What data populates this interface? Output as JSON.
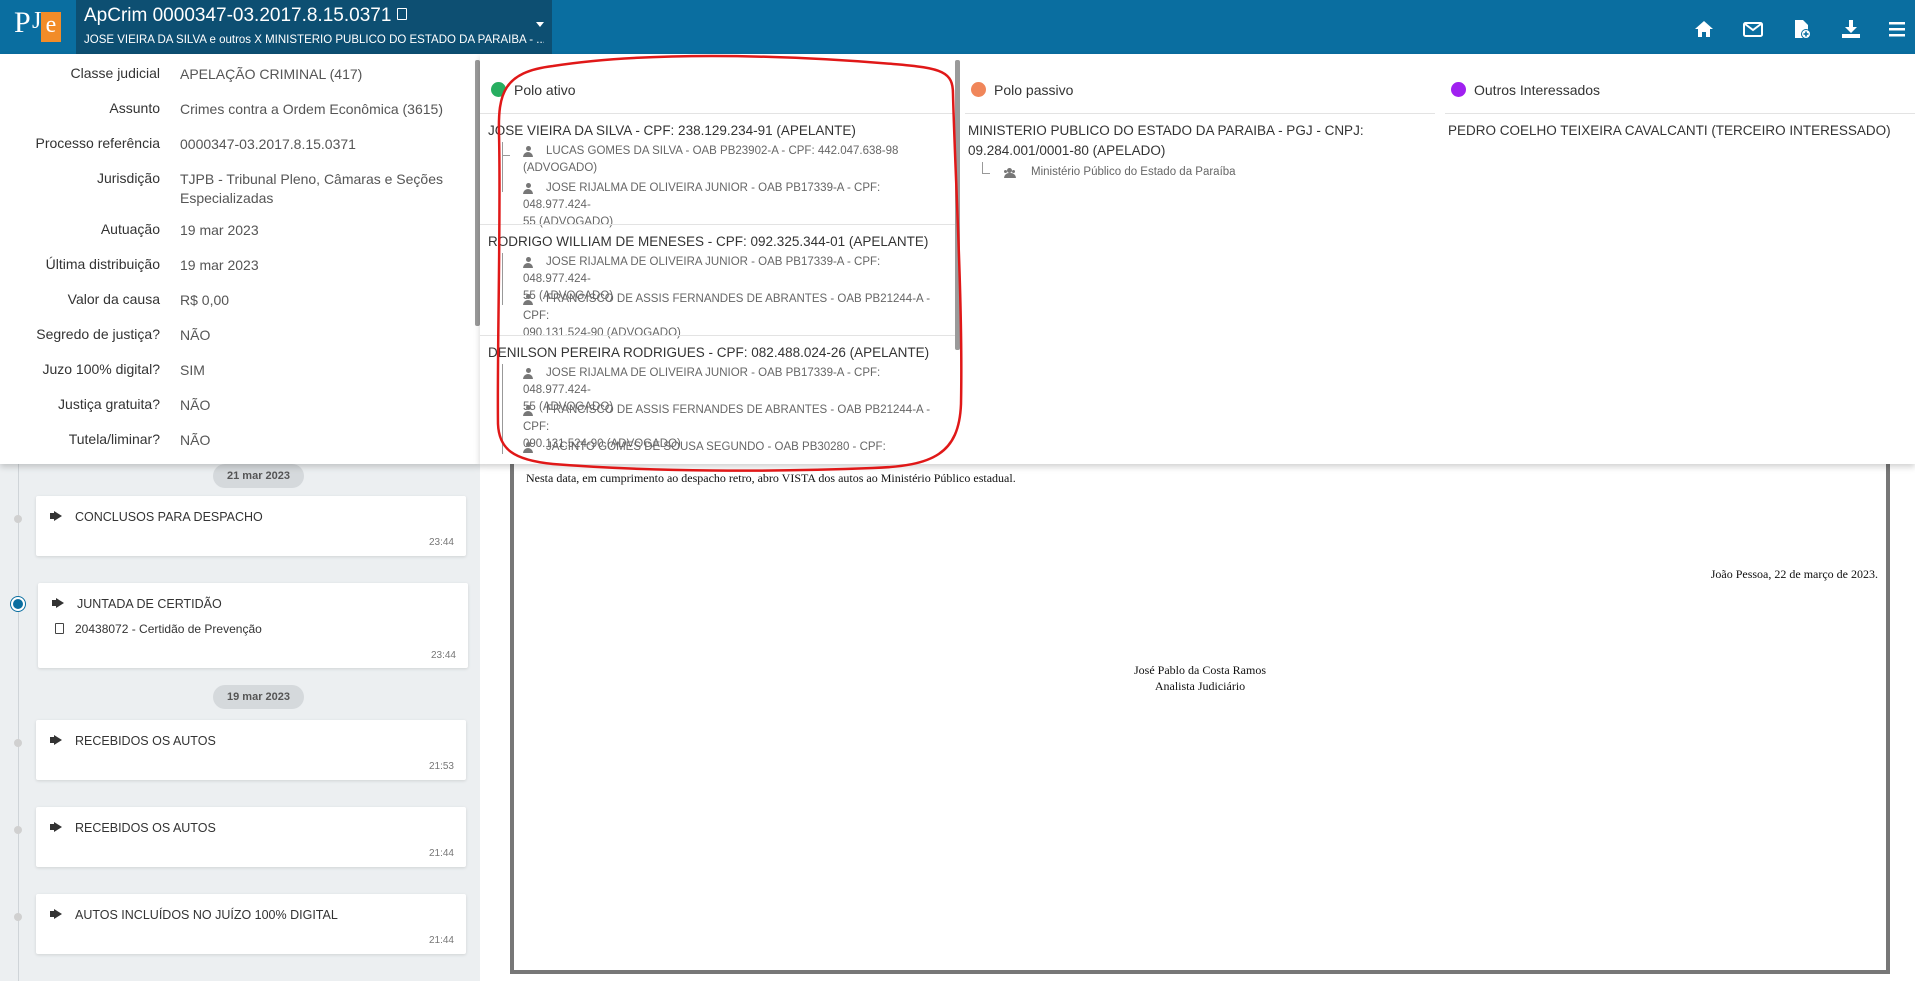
{
  "header": {
    "process_title": "ApCrim 0000347-03.2017.8.15.0371",
    "process_subtitle": "JOSE VIEIRA DA SILVA e outros X MINISTERIO PUBLICO DO ESTADO DA PARAIBA - ...",
    "logo_p": "P",
    "logo_j": "J",
    "logo_e": "e"
  },
  "info": [
    {
      "label": "Classe judicial",
      "value": "APELAÇÃO CRIMINAL (417)"
    },
    {
      "label": "Assunto",
      "value": "Crimes contra a Ordem Econômica (3615)"
    },
    {
      "label": "Processo referência",
      "value": "0000347-03.2017.8.15.0371"
    },
    {
      "label": "Jurisdição",
      "value": "TJPB - Tribunal Pleno, Câmaras e Seções Especializadas"
    },
    {
      "label": "Autuação",
      "value": "19 mar 2023"
    },
    {
      "label": "Última distribuição",
      "value": "19 mar 2023"
    },
    {
      "label": "Valor da causa",
      "value": "R$ 0,00"
    },
    {
      "label": "Segredo de justiça?",
      "value": "NÃO"
    },
    {
      "label": "Juzo 100% digital?",
      "value": "SIM"
    },
    {
      "label": "Justiça gratuita?",
      "value": "NÃO"
    },
    {
      "label": "Tutela/liminar?",
      "value": "NÃO"
    }
  ],
  "parties": {
    "ativo_label": "Polo ativo",
    "passivo_label": "Polo passivo",
    "outros_label": "Outros Interessados",
    "colors": {
      "ativo": "#27ae60",
      "passivo": "#f0865a",
      "outros": "#a020f0"
    },
    "ativo": [
      {
        "name": "JOSE VIEIRA DA SILVA - CPF: 238.129.234-91 (APELANTE)",
        "lawyers": [
          {
            "l1": "LUCAS GOMES DA SILVA - OAB PB23902-A - CPF: 442.047.638-98",
            "l2": "(ADVOGADO)"
          },
          {
            "l1": "JOSE RIJALMA DE OLIVEIRA JUNIOR - OAB PB17339-A - CPF: 048.977.424-",
            "l2": "55 (ADVOGADO)"
          }
        ]
      },
      {
        "name": "RODRIGO WILLIAM DE MENESES - CPF: 092.325.344-01 (APELANTE)",
        "lawyers": [
          {
            "l1": "JOSE RIJALMA DE OLIVEIRA JUNIOR - OAB PB17339-A - CPF: 048.977.424-",
            "l2": "55 (ADVOGADO)"
          },
          {
            "l1": "FRANCISCO DE ASSIS FERNANDES DE ABRANTES - OAB PB21244-A - CPF:",
            "l2": "090.131.524-90 (ADVOGADO)"
          }
        ]
      },
      {
        "name": "DENILSON PEREIRA RODRIGUES - CPF: 082.488.024-26 (APELANTE)",
        "lawyers": [
          {
            "l1": "JOSE RIJALMA DE OLIVEIRA JUNIOR - OAB PB17339-A - CPF: 048.977.424-",
            "l2": "55 (ADVOGADO)"
          },
          {
            "l1": "FRANCISCO DE ASSIS FERNANDES DE ABRANTES - OAB PB21244-A - CPF:",
            "l2": "090.131.524-90 (ADVOGADO)"
          },
          {
            "l1": "JACINTO GOMES DE SOUSA SEGUNDO - OAB PB30280 - CPF:",
            "l2": ""
          }
        ]
      }
    ],
    "passivo": {
      "name_l1": "MINISTERIO PUBLICO DO ESTADO DA PARAIBA - PGJ - CNPJ:",
      "name_l2": "09.284.001/0001-80 (APELADO)",
      "rep": "Ministério Público do Estado da Paraíba"
    },
    "outros": {
      "name": "PEDRO COELHO TEIXEIRA CAVALCANTI (TERCEIRO INTERESSADO)"
    }
  },
  "timeline": {
    "date1": "21 mar 2023",
    "date2": "19 mar 2023",
    "events": [
      {
        "title": "CONCLUSOS PARA DESPACHO",
        "time": "23:44"
      },
      {
        "title": "JUNTADA DE CERTIDÃO",
        "doc": "20438072 - Certidão de Prevenção",
        "time": "23:44"
      },
      {
        "title": "RECEBIDOS OS AUTOS",
        "time": "21:53"
      },
      {
        "title": "RECEBIDOS OS AUTOS",
        "time": "21:44"
      },
      {
        "title": "AUTOS INCLUÍDOS NO JUÍZO 100% DIGITAL",
        "time": "21:44"
      }
    ]
  },
  "document": {
    "line1": "Nesta data, em cumprimento ao despacho retro, abro VISTA dos autos ao Ministério Público estadual.",
    "place_date": "João Pessoa, 22 de março de 2023.",
    "signer_name": "José Pablo da Costa Ramos",
    "signer_role": "Analista Judiciário"
  }
}
